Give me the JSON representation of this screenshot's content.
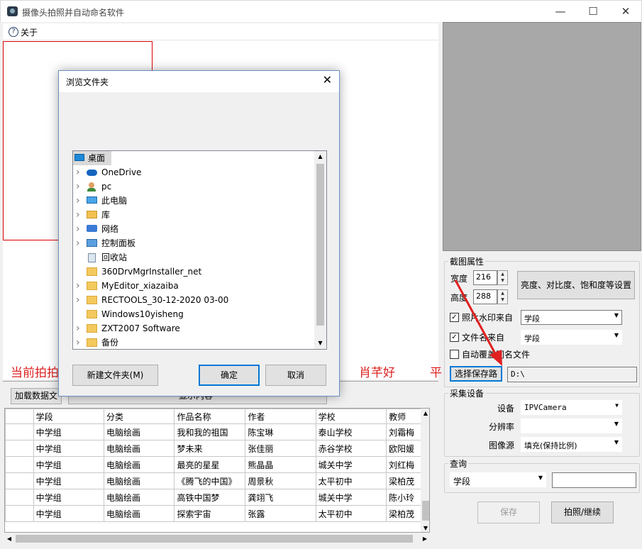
{
  "window": {
    "title": "摄像头拍照并自动命名软件"
  },
  "menu": {
    "about": "关于"
  },
  "red_texts": [
    "当前拍拍",
    "肖芊好",
    "平"
  ],
  "toolbar": {
    "load_data": "加载数据文",
    "hidden_tab": "显示内容"
  },
  "dialog": {
    "title": "浏览文件夹",
    "items": [
      {
        "label": "桌面",
        "icon": "desktop-icon",
        "expand": false,
        "selected": true
      },
      {
        "label": "OneDrive",
        "icon": "cloud-icon",
        "expand": true
      },
      {
        "label": "pc",
        "icon": "user-icon",
        "expand": true
      },
      {
        "label": "此电脑",
        "icon": "computer-icon",
        "expand": true
      },
      {
        "label": "库",
        "icon": "library-icon",
        "expand": true
      },
      {
        "label": "网络",
        "icon": "network-icon",
        "expand": true
      },
      {
        "label": "控制面板",
        "icon": "control-panel-icon",
        "expand": true
      },
      {
        "label": "回收站",
        "icon": "recycle-bin-icon",
        "expand": false
      },
      {
        "label": "360DrvMgrInstaller_net",
        "icon": "folder-icon",
        "expand": false
      },
      {
        "label": "MyEditor_xiazaiba",
        "icon": "folder-icon",
        "expand": true
      },
      {
        "label": "RECTOOLS_30-12-2020 03-00",
        "icon": "folder-icon",
        "expand": true
      },
      {
        "label": "Windows10yisheng",
        "icon": "folder-icon",
        "expand": false
      },
      {
        "label": "ZXT2007 Software",
        "icon": "folder-icon",
        "expand": true
      },
      {
        "label": "备份",
        "icon": "folder-icon",
        "expand": true
      }
    ],
    "new_folder": "新建文件夹(M)",
    "ok": "确定",
    "cancel": "取消"
  },
  "capture": {
    "group_label": "截图属性",
    "width_label": "宽度",
    "width_value": "216",
    "height_label": "高度",
    "height_value": "288",
    "adjust_button": "亮度、对比度、饱和度等设置",
    "watermark_label": "照片水印来自",
    "watermark_checked": true,
    "watermark_source": "学段",
    "filename_label": "文件名来自",
    "filename_checked": true,
    "filename_source": "学段",
    "overwrite_label": "自动覆盖同名文件",
    "overwrite_checked": false,
    "choose_path_button": "选择保存路",
    "path_value": "D:\\"
  },
  "device": {
    "group_label": "采集设备",
    "device_label": "设备",
    "device_value": "IPVCamera",
    "resolution_label": "分辨率",
    "resolution_value": "",
    "source_label": "图像源",
    "source_value": "填充(保持比例)"
  },
  "query": {
    "group_label": "查询",
    "field_value": "学段",
    "input_value": ""
  },
  "actions": {
    "save": "保存",
    "capture": "拍照/继续"
  },
  "grid": {
    "columns": [
      "学段",
      "分类",
      "作品名称",
      "作者",
      "学校",
      "教师"
    ],
    "rows": [
      [
        "中学组",
        "电脑绘画",
        "我和我的祖国",
        "陈宝琳",
        "泰山学校",
        "刘霜梅"
      ],
      [
        "中学组",
        "电脑绘画",
        "梦未来",
        "张佳丽",
        "赤谷学校",
        "欧阳媛"
      ],
      [
        "中学组",
        "电脑绘画",
        "最亮的星星",
        "熊晶晶",
        "城关中学",
        "刘红梅"
      ],
      [
        "中学组",
        "电脑绘画",
        "《腾飞的中国》",
        "周景秋",
        "太平初中",
        "梁柏茂"
      ],
      [
        "中学组",
        "电脑绘画",
        "高铁中国梦",
        "龚翊飞",
        "城关中学",
        "陈小玲"
      ],
      [
        "中学组",
        "电脑绘画",
        "探索宇宙",
        "张露",
        "太平初中",
        "梁柏茂"
      ]
    ]
  },
  "colors": {
    "accent": "#0078d7",
    "red": "#d22222",
    "preview": "#a8a8a8"
  }
}
